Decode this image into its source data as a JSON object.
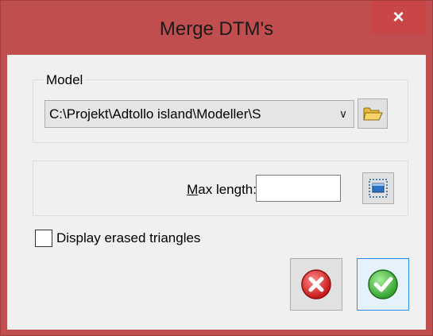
{
  "window": {
    "title": "Merge DTM's",
    "close_label": "×"
  },
  "model": {
    "group_label": "Model",
    "selected_value": "C:\\Projekt\\Adtollo island\\Modeller\\S",
    "dropdown_glyph": "∨",
    "browse_icon": "folder-icon"
  },
  "max_length": {
    "label_prefix": "M",
    "label_rest": "ax length:",
    "value": "",
    "pick_icon": "select-rectangle-icon"
  },
  "options": {
    "display_erased_label": "Display erased triangles",
    "display_erased_checked": false
  },
  "buttons": {
    "cancel_icon": "cancel-icon",
    "ok_icon": "ok-check-icon"
  },
  "colors": {
    "titlebar": "#c14e4f",
    "close_button": "#c94646",
    "client_bg": "#f0f0f0",
    "ok_border": "#2f8be0"
  }
}
